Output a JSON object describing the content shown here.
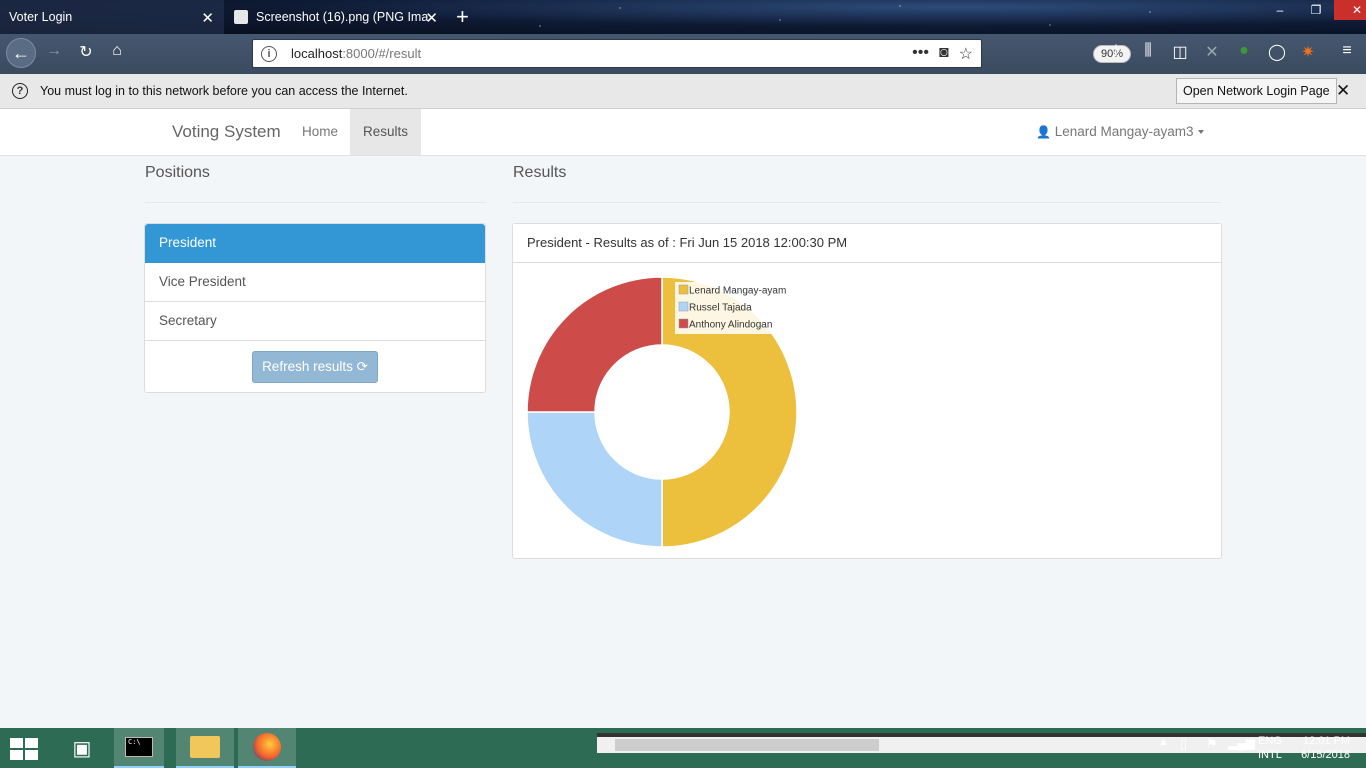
{
  "browser": {
    "tabs": [
      {
        "title": "Voter Login",
        "active": true
      },
      {
        "title": "Screenshot (16).png (PNG Ima",
        "active": false
      }
    ],
    "url_host": "localhost",
    "url_path": ":8000/#/result",
    "zoom": "90%"
  },
  "notification": {
    "message": "You must log in to this network before you can access the Internet.",
    "button": "Open Network Login Page"
  },
  "navbar": {
    "brand": "Voting System",
    "items": [
      "Home",
      "Results"
    ],
    "user": "Lenard Mangay-ayam3"
  },
  "positions": {
    "heading": "Positions",
    "items": [
      "President",
      "Vice President",
      "Secretary"
    ],
    "active": "President",
    "refresh_label": "Refresh results"
  },
  "results": {
    "heading": "Results",
    "panel_title": "President - Results as of : Fri Jun 15 2018 12:00:30 PM"
  },
  "chart_data": {
    "type": "pie",
    "donut": true,
    "categories": [
      "Lenard Mangay-ayam",
      "Russel Tajada",
      "Anthony Alindogan"
    ],
    "values": [
      2,
      1,
      1
    ],
    "colors": [
      "#ecc03d",
      "#aed5f8",
      "#cd4b48"
    ],
    "legend_position": "top-right",
    "title": ""
  },
  "taskbar": {
    "lang_line1": "ENG",
    "lang_line2": "INTL",
    "time": "12:01 PM",
    "date": "6/15/2018"
  }
}
